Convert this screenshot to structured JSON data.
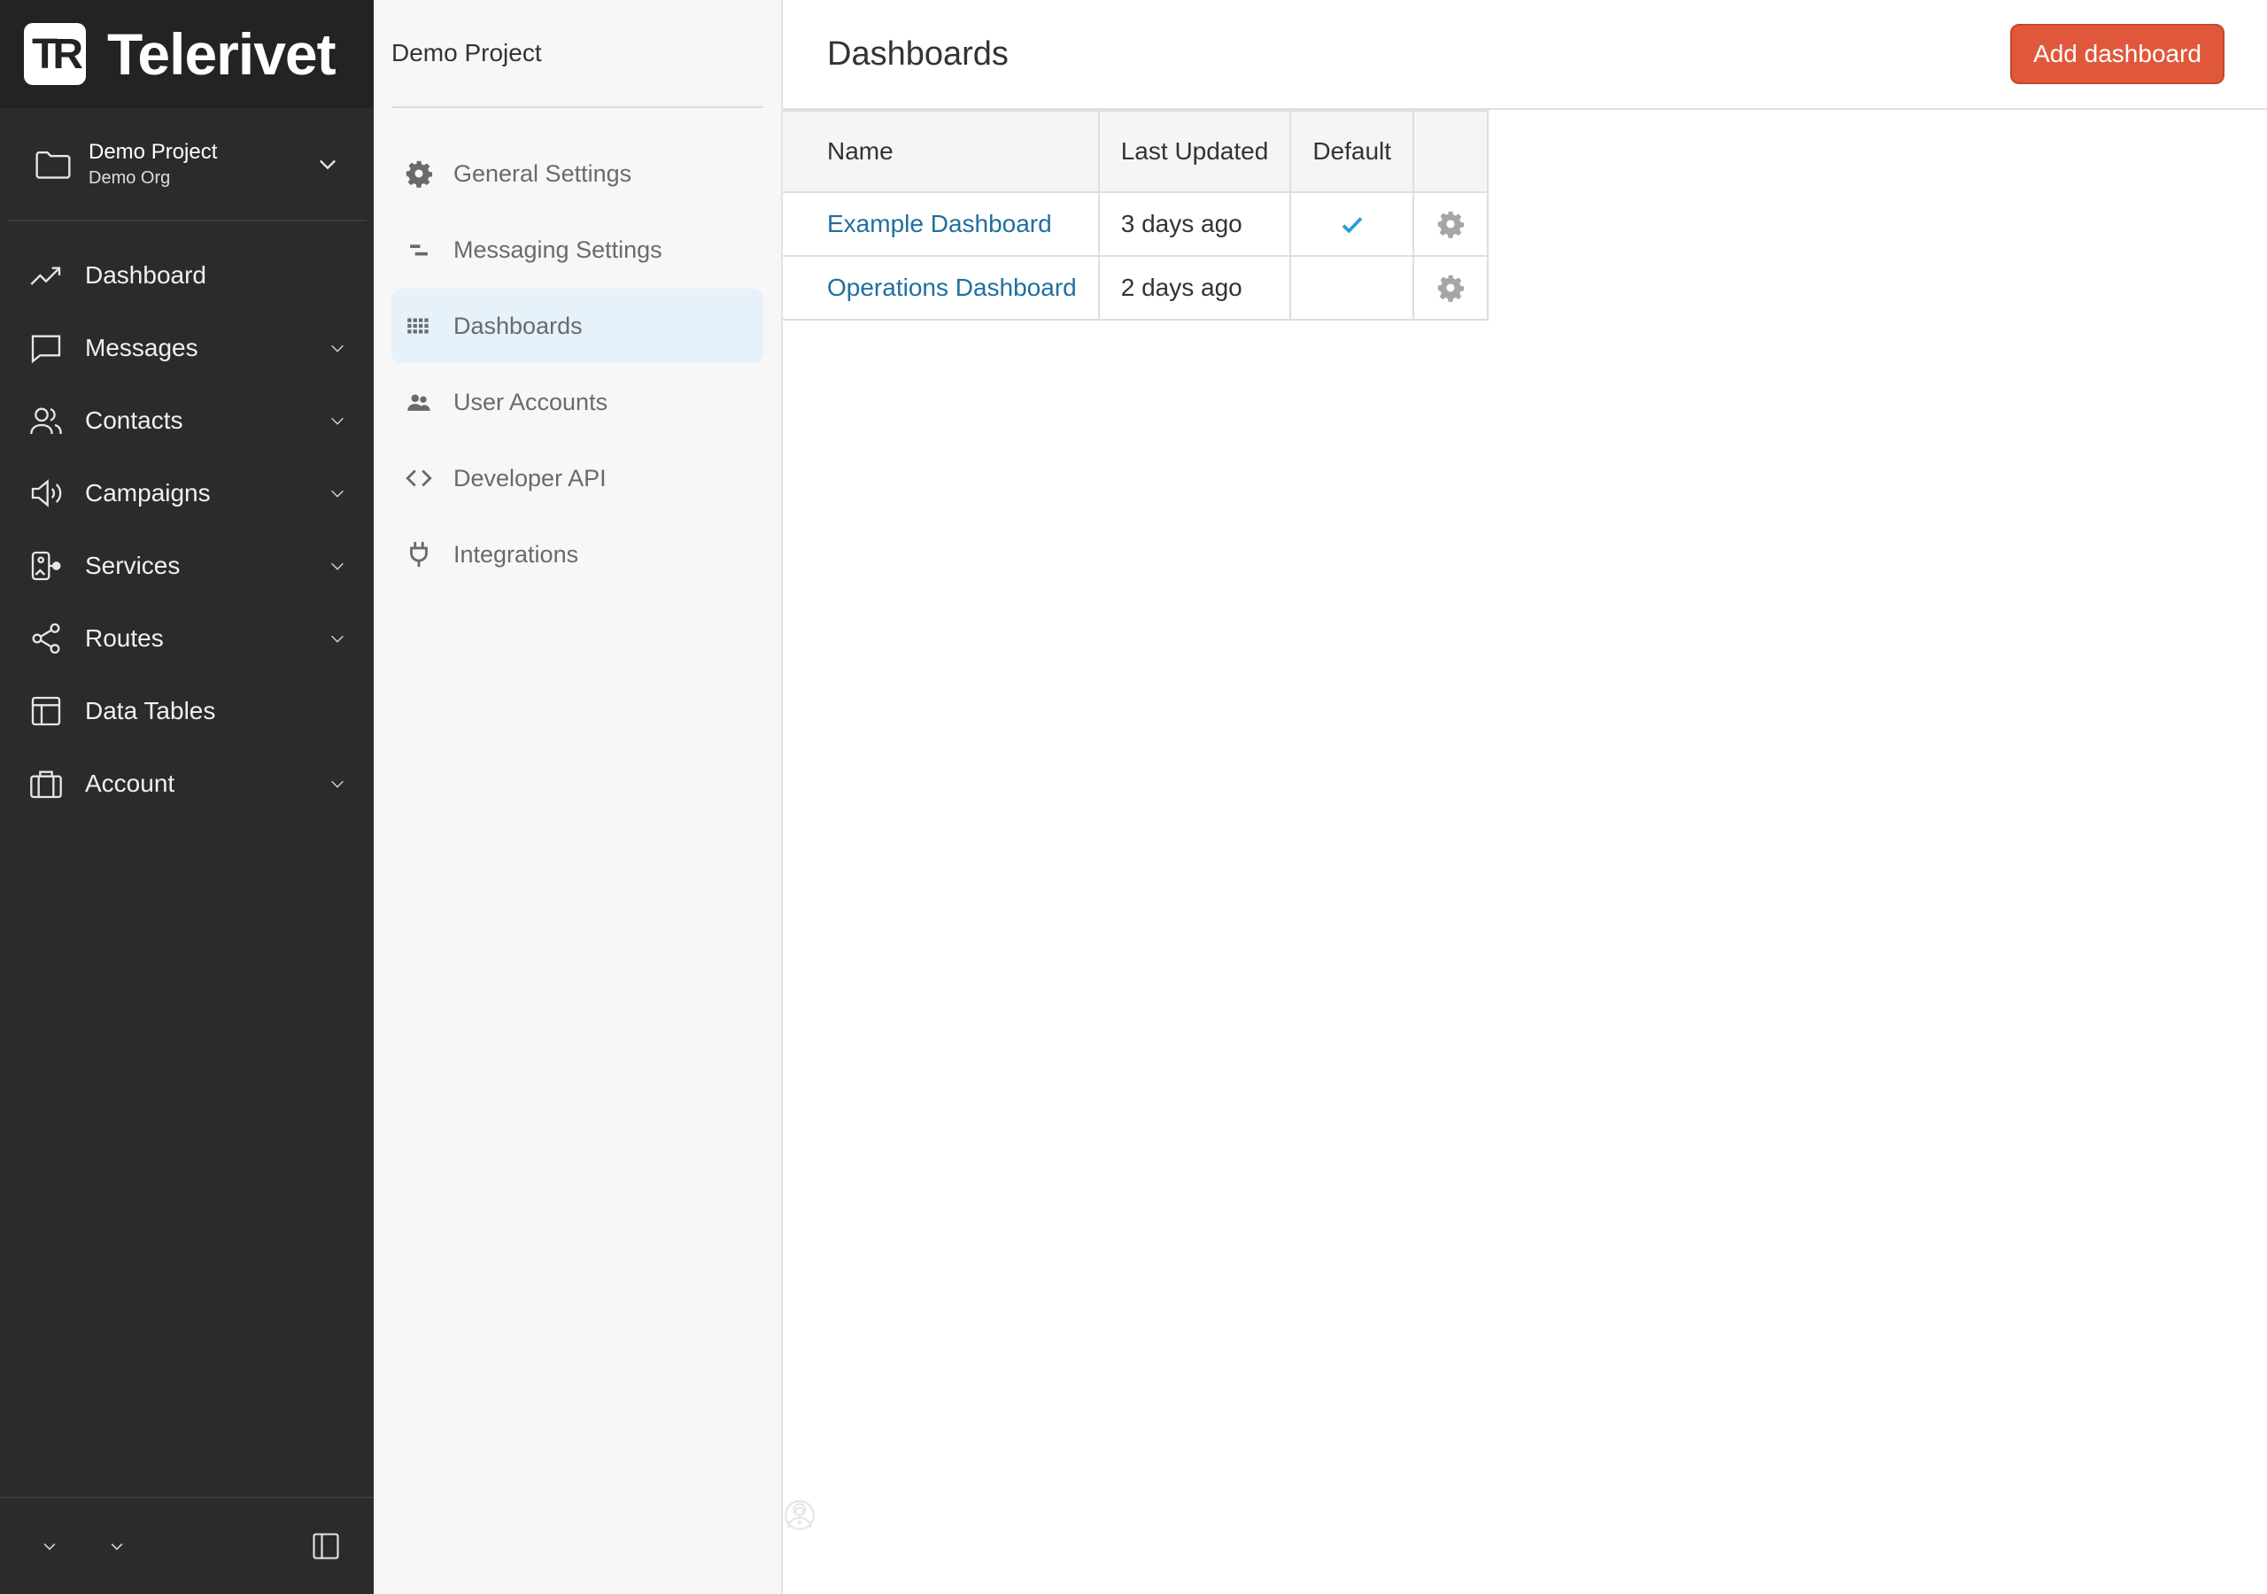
{
  "brand": {
    "name": "Telerivet",
    "logo_text": "TR"
  },
  "project": {
    "name": "Demo Project",
    "org": "Demo Org"
  },
  "nav": [
    {
      "label": "Dashboard",
      "icon": "trending-up-icon",
      "expandable": false
    },
    {
      "label": "Messages",
      "icon": "chat-bubble-icon",
      "expandable": true
    },
    {
      "label": "Contacts",
      "icon": "users-icon",
      "expandable": true
    },
    {
      "label": "Campaigns",
      "icon": "megaphone-icon",
      "expandable": true
    },
    {
      "label": "Services",
      "icon": "services-icon",
      "expandable": true
    },
    {
      "label": "Routes",
      "icon": "share-icon",
      "expandable": true
    },
    {
      "label": "Data Tables",
      "icon": "table-icon",
      "expandable": false
    },
    {
      "label": "Account",
      "icon": "briefcase-icon",
      "expandable": true
    }
  ],
  "subnav": {
    "title": "Demo Project",
    "items": [
      {
        "label": "General Settings",
        "icon": "gear-icon",
        "active": false
      },
      {
        "label": "Messaging Settings",
        "icon": "messaging-icon",
        "active": false
      },
      {
        "label": "Dashboards",
        "icon": "grid-icon",
        "active": true
      },
      {
        "label": "User Accounts",
        "icon": "user-accounts-icon",
        "active": false
      },
      {
        "label": "Developer API",
        "icon": "code-icon",
        "active": false
      },
      {
        "label": "Integrations",
        "icon": "plug-icon",
        "active": false
      }
    ]
  },
  "main": {
    "title": "Dashboards",
    "add_button": "Add dashboard",
    "table": {
      "headers": [
        "Name",
        "Last Updated",
        "Default",
        ""
      ],
      "rows": [
        {
          "name": "Example Dashboard",
          "updated": "3 days ago",
          "default": true
        },
        {
          "name": "Operations Dashboard",
          "updated": "2 days ago",
          "default": false
        }
      ]
    }
  },
  "colors": {
    "sidebar_bg": "#2b2b2b",
    "accent_button": "#e0583b",
    "link": "#1f6f9f",
    "active_subnav": "#e6f1fa",
    "check": "#2a9fd8"
  }
}
